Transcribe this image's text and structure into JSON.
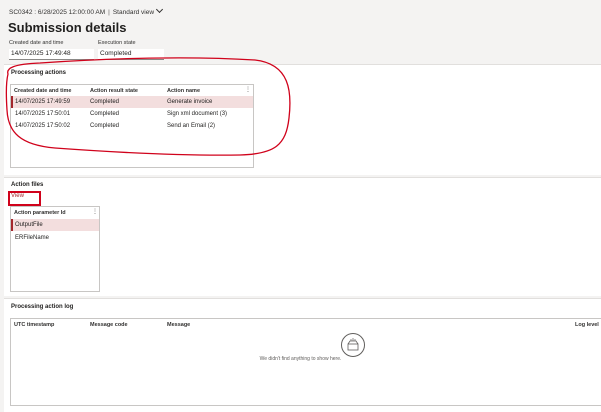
{
  "header": {
    "record": "SC0342 : 6/28/2025 12:00:00 AM",
    "separator": "|",
    "view_label": "Standard view",
    "title": "Submission details"
  },
  "fields": {
    "created_label": "Created date and time",
    "created_value": "14/07/2025 17:49:48",
    "state_label": "Execution state",
    "state_value": "Completed"
  },
  "processing_actions": {
    "title": "Processing actions",
    "columns": [
      "Created date and time",
      "Action result state",
      "Action name"
    ],
    "rows": [
      {
        "created": "14/07/2025 17:49:59",
        "state": "Completed",
        "name": "Generate invoice"
      },
      {
        "created": "14/07/2025 17:50:01",
        "state": "Completed",
        "name": "Sign xml document (3)"
      },
      {
        "created": "14/07/2025 17:50:02",
        "state": "Completed",
        "name": "Send an Email (2)"
      }
    ]
  },
  "action_files": {
    "title": "Action files",
    "view_button": "View",
    "column": "Action parameter Id",
    "rows": [
      "OutputFile",
      "ERFileName"
    ]
  },
  "action_log": {
    "title": "Processing action log",
    "columns": [
      "UTC timestamp",
      "Message code",
      "Message",
      "Log level"
    ],
    "empty_text": "We didn't find anything to show here."
  },
  "annotation_color": "#d0021b",
  "selection_color": "#f3dede"
}
